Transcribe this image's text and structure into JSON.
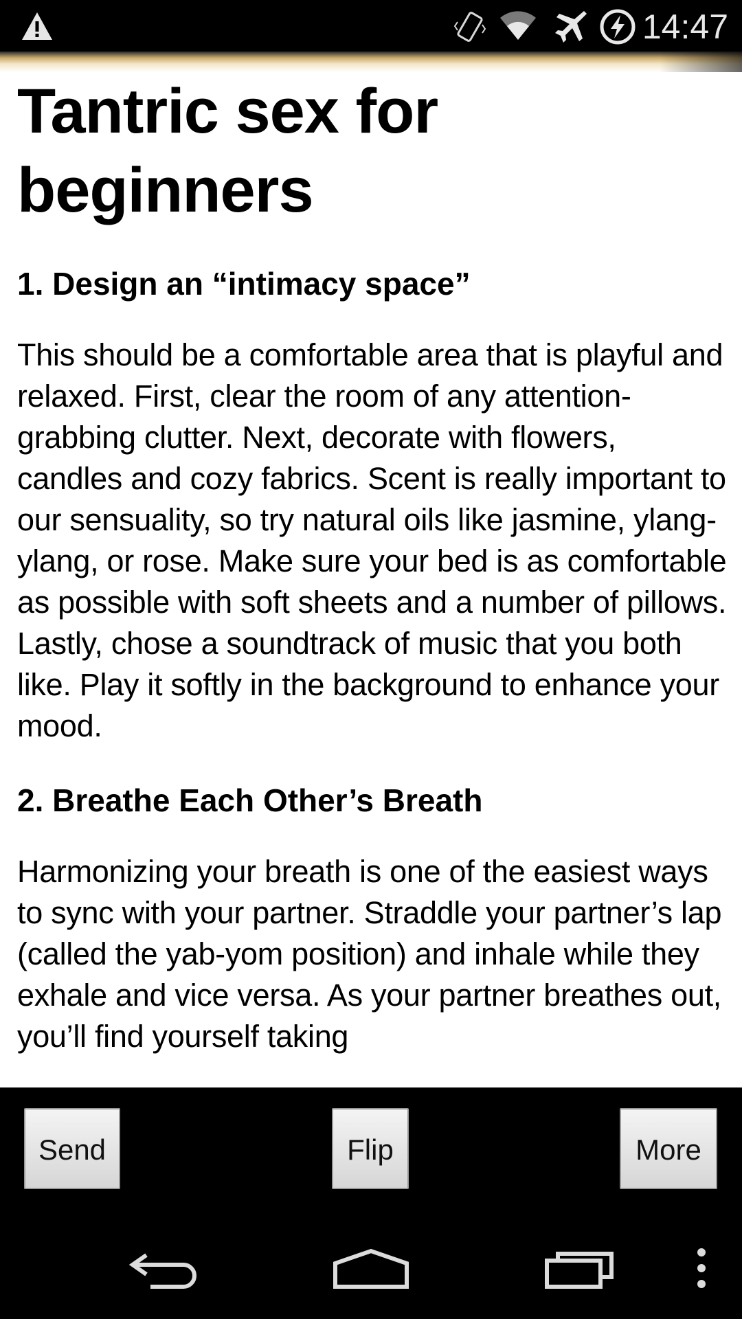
{
  "status_bar": {
    "time": "14:47",
    "icons": [
      "warning-icon",
      "vibrate-icon",
      "wifi-icon",
      "airplane-mode-icon",
      "battery-charging-icon"
    ]
  },
  "article": {
    "title": "Tantric sex for beginners",
    "sections": [
      {
        "heading": "1. Design an “intimacy space”",
        "body": "This should be a comfortable area that is playful and relaxed. First, clear the room of any attention-grabbing clutter. Next, decorate with flowers, candles and cozy fabrics. Scent is really important to our sensuality, so try natural oils like jasmine, ylang-ylang, or rose. Make sure your bed is as comfortable as possible with soft sheets and a number of pillows. Lastly, chose a soundtrack of music that you both like. Play it softly in the background to enhance your mood."
      },
      {
        "heading": "2. Breathe Each Other’s Breath",
        "body": "Harmonizing your breath is one of the easiest ways to sync with your partner. Straddle your partner’s lap (called the yab-yom position) and inhale while they exhale and vice versa. As your partner breathes out, you’ll find yourself taking"
      }
    ]
  },
  "actions": {
    "send": "Send",
    "flip": "Flip",
    "more": "More"
  },
  "nav": {
    "icons": [
      "back-icon",
      "home-icon",
      "recent-apps-icon",
      "overflow-menu-icon"
    ]
  }
}
